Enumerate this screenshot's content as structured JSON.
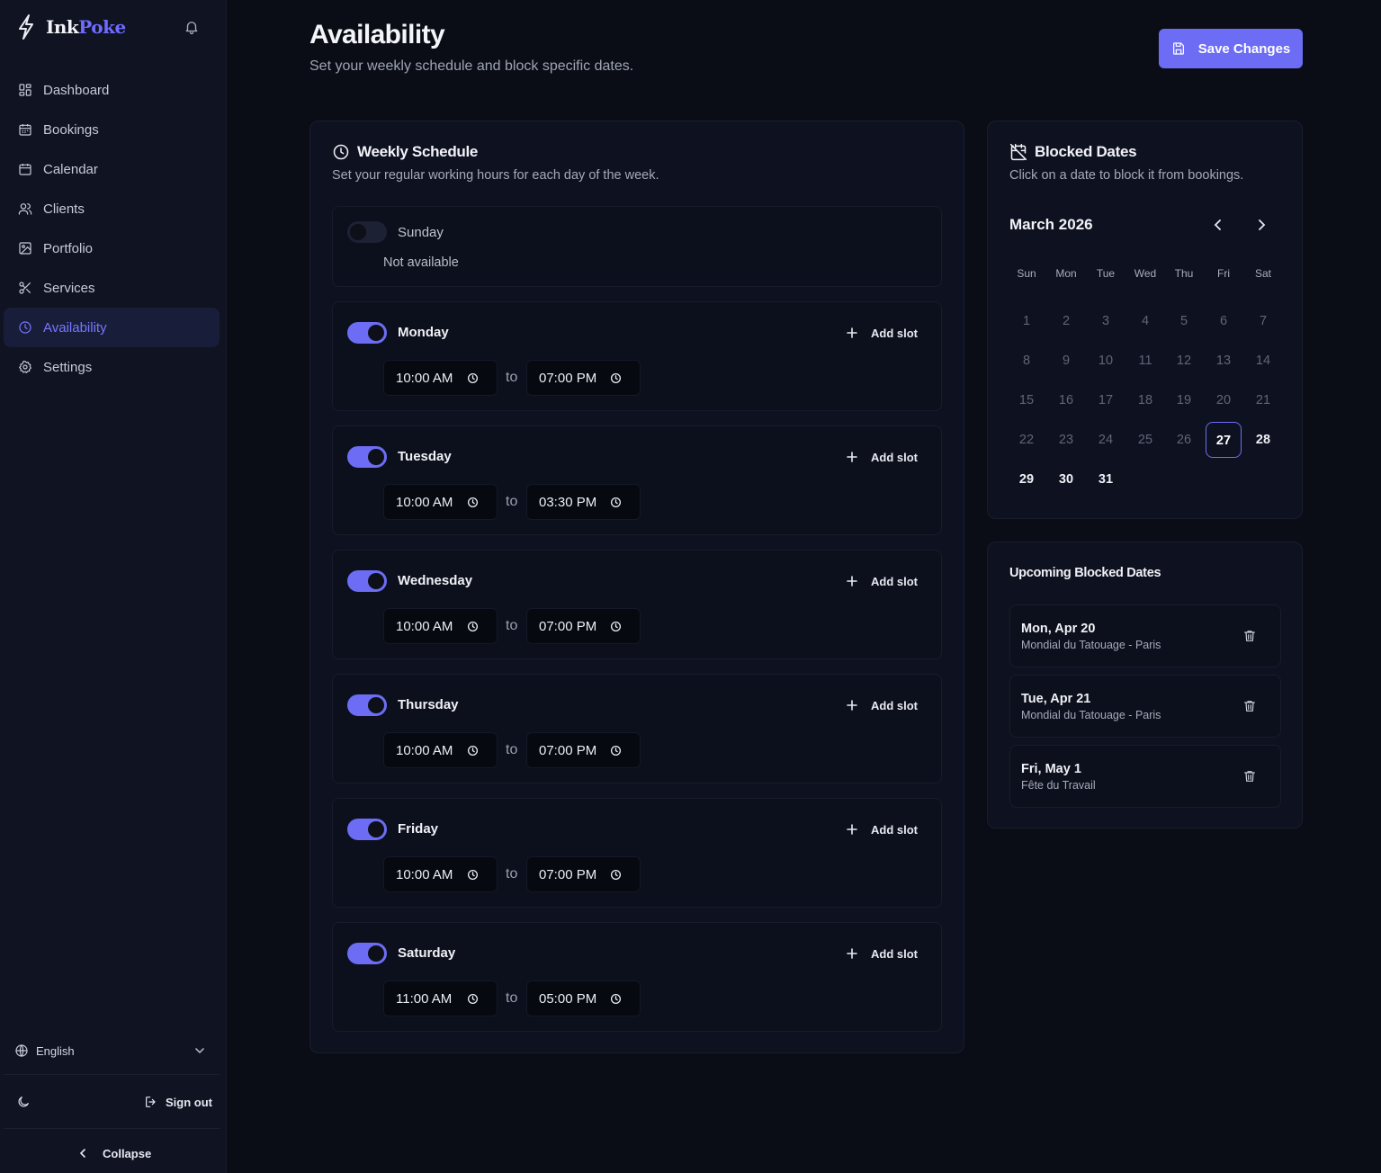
{
  "app": {
    "brand_ink": "Ink",
    "brand_poke": "Poke",
    "accent_color": "#6c6cf4"
  },
  "sidebar": {
    "items": [
      {
        "label": "Dashboard",
        "icon": "dashboard-icon"
      },
      {
        "label": "Bookings",
        "icon": "calendar-grid-icon"
      },
      {
        "label": "Calendar",
        "icon": "calendar-icon"
      },
      {
        "label": "Clients",
        "icon": "users-icon"
      },
      {
        "label": "Portfolio",
        "icon": "image-icon"
      },
      {
        "label": "Services",
        "icon": "scissors-icon"
      },
      {
        "label": "Availability",
        "icon": "clock-icon",
        "active": true
      },
      {
        "label": "Settings",
        "icon": "gear-icon"
      }
    ],
    "language": "English",
    "sign_out": "Sign out",
    "collapse": "Collapse"
  },
  "header": {
    "title": "Availability",
    "subtitle": "Set your weekly schedule and block specific dates.",
    "save_label": "Save Changes"
  },
  "weekly": {
    "title": "Weekly Schedule",
    "subtitle": "Set your regular working hours for each day of the week.",
    "add_slot_label": "Add slot",
    "to_label": "to",
    "not_available_label": "Not available",
    "days": [
      {
        "name": "Sunday",
        "enabled": false
      },
      {
        "name": "Monday",
        "enabled": true,
        "start": "10:00 AM",
        "end": "07:00 PM"
      },
      {
        "name": "Tuesday",
        "enabled": true,
        "start": "10:00 AM",
        "end": "03:30 PM"
      },
      {
        "name": "Wednesday",
        "enabled": true,
        "start": "10:00 AM",
        "end": "07:00 PM"
      },
      {
        "name": "Thursday",
        "enabled": true,
        "start": "10:00 AM",
        "end": "07:00 PM"
      },
      {
        "name": "Friday",
        "enabled": true,
        "start": "10:00 AM",
        "end": "07:00 PM"
      },
      {
        "name": "Saturday",
        "enabled": true,
        "start": "11:00 AM",
        "end": "05:00 PM"
      }
    ]
  },
  "blocked": {
    "title": "Blocked Dates",
    "subtitle": "Click on a date to block it from bookings.",
    "month": "March 2026",
    "weekdays": [
      "Sun",
      "Mon",
      "Tue",
      "Wed",
      "Thu",
      "Fri",
      "Sat"
    ],
    "days": [
      "1",
      "2",
      "3",
      "4",
      "5",
      "6",
      "7",
      "8",
      "9",
      "10",
      "11",
      "12",
      "13",
      "14",
      "15",
      "16",
      "17",
      "18",
      "19",
      "20",
      "21",
      "22",
      "23",
      "24",
      "25",
      "26",
      "27",
      "28",
      "29",
      "30",
      "31"
    ],
    "today": "27"
  },
  "upcoming": {
    "title": "Upcoming Blocked Dates",
    "items": [
      {
        "date": "Mon, Apr 20",
        "desc": "Mondial du Tatouage - Paris"
      },
      {
        "date": "Tue, Apr 21",
        "desc": "Mondial du Tatouage - Paris"
      },
      {
        "date": "Fri, May 1",
        "desc": "Fête du Travail"
      }
    ]
  }
}
